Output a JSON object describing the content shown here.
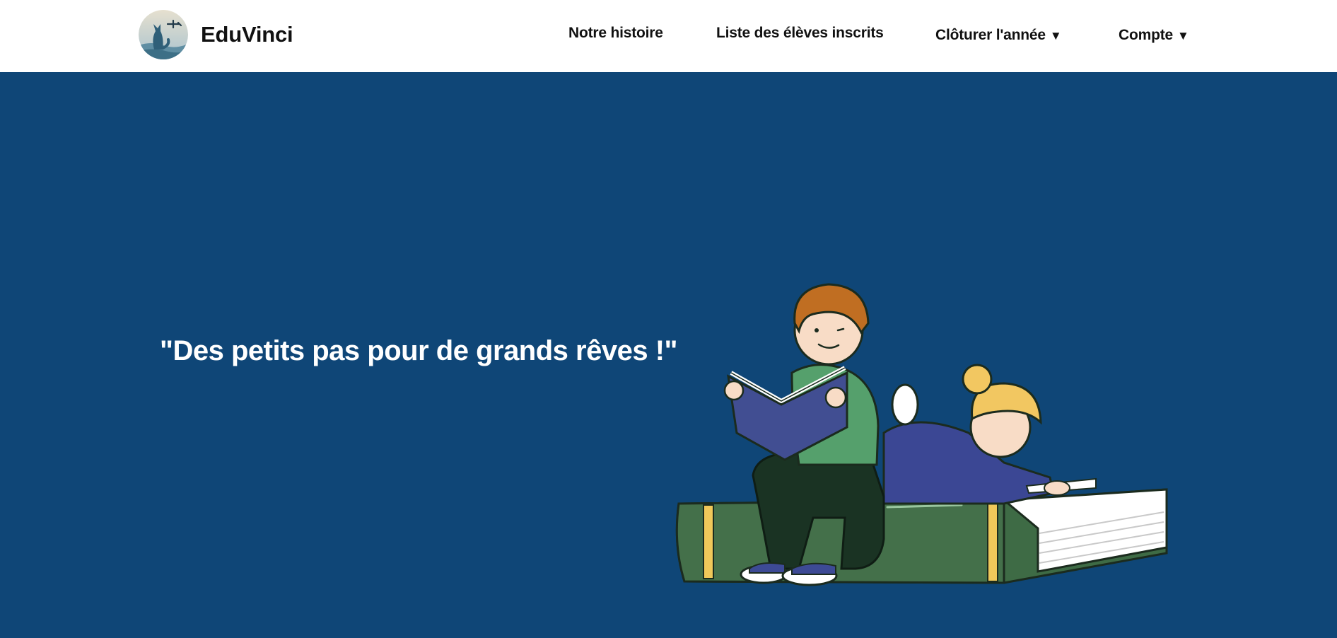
{
  "brand": {
    "name": "EduVinci",
    "logo_icon": "fox-airplane-logo-icon"
  },
  "nav": {
    "history": "Notre histoire",
    "students": "Liste des élèves inscrits",
    "close_year": "Clôturer l'année",
    "account": "Compte",
    "caret": "▼"
  },
  "hero": {
    "slogan": "\"Des petits pas pour de grands rêves !\"",
    "illustration": "children-reading-on-book-illustration"
  },
  "colors": {
    "header_bg": "#ffffff",
    "hero_bg": "#0f4677",
    "nav_text": "#111111",
    "slogan_text": "#ffffff"
  }
}
